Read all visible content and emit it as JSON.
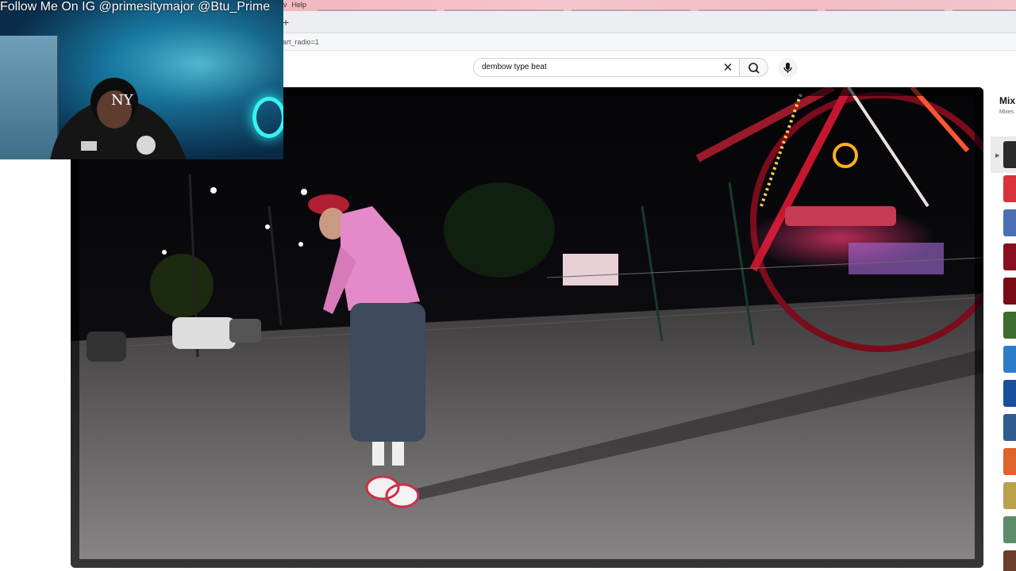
{
  "browser": {
    "menu_items": [
      "v",
      "Help"
    ],
    "new_tab_icon": "plus-icon",
    "address_url_fragment": "art_radio=1"
  },
  "search": {
    "query": "dembow type beat",
    "clear_icon": "close-icon",
    "search_icon": "search-icon",
    "mic_icon": "microphone-icon"
  },
  "stream_overlay": {
    "caption": "Follow Me On IG @primesitymajor @Btu_Prime"
  },
  "rail": {
    "title": "Mix",
    "subtitle": "Mixes",
    "now_playing_icon": "play-indicator-icon",
    "thumb_colors": [
      "#2a2a2a",
      "#d9323a",
      "#4a6fb5",
      "#8a1020",
      "#7a0b14",
      "#3e6b2e",
      "#2b7cc9",
      "#1a4f9e",
      "#2d5d8f",
      "#e0632a",
      "#b9a24a",
      "#5c8c6a",
      "#6b3d2a"
    ]
  },
  "colors": {
    "accent": "#ff0000"
  }
}
